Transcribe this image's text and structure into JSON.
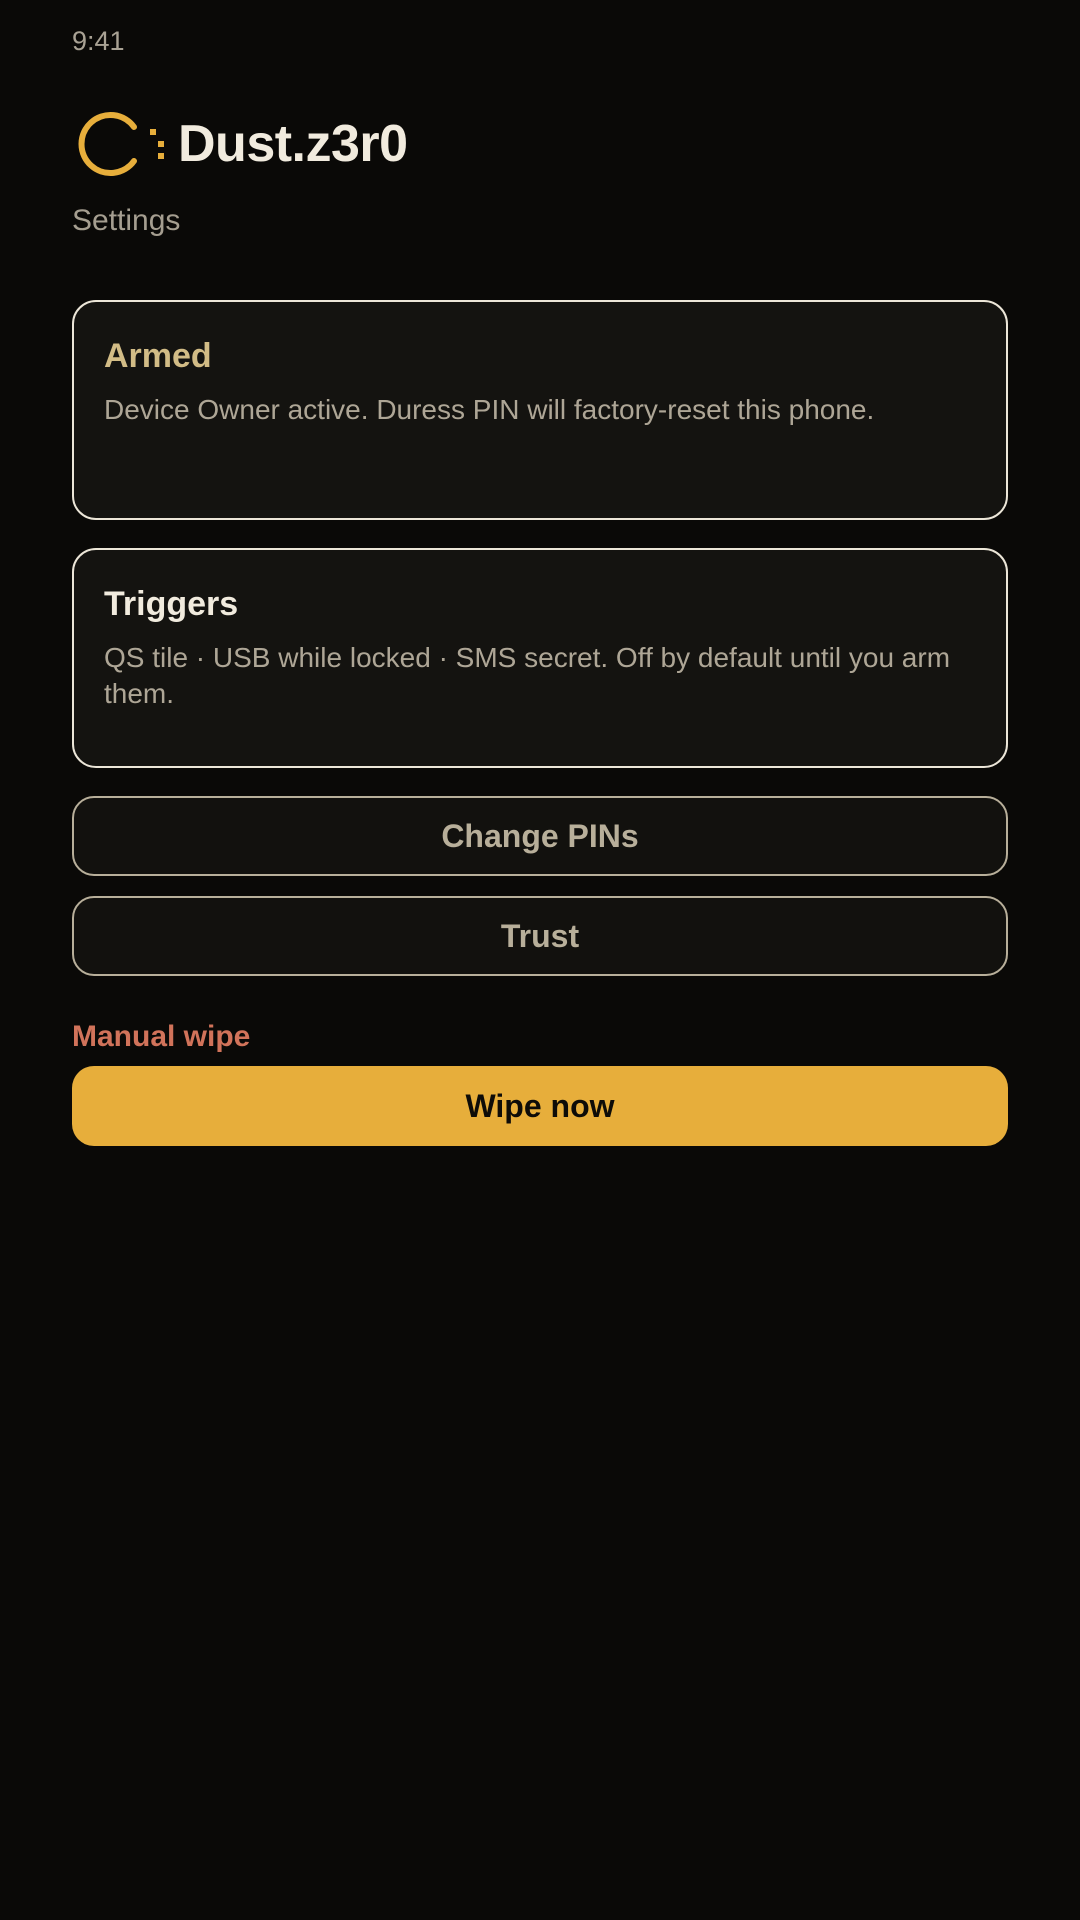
{
  "status_bar": {
    "time": "9:41"
  },
  "header": {
    "app_title": "Dust.z3r0",
    "subtitle": "Settings",
    "logo_icon": "dust-logo-icon"
  },
  "cards": {
    "armed": {
      "title": "Armed",
      "text": "Device Owner active. Duress PIN will factory-reset this phone."
    },
    "triggers": {
      "title": "Triggers",
      "text": "QS tile · USB while locked · SMS secret. Off by default until you arm them."
    }
  },
  "buttons": {
    "change_pins": "Change PINs",
    "trust": "Trust"
  },
  "manual_wipe": {
    "label": "Manual wipe",
    "button": "Wipe now"
  },
  "colors": {
    "background": "#0a0907",
    "accent": "#e7ae3b",
    "danger": "#d1735a",
    "armed_title": "#d2bc86"
  }
}
